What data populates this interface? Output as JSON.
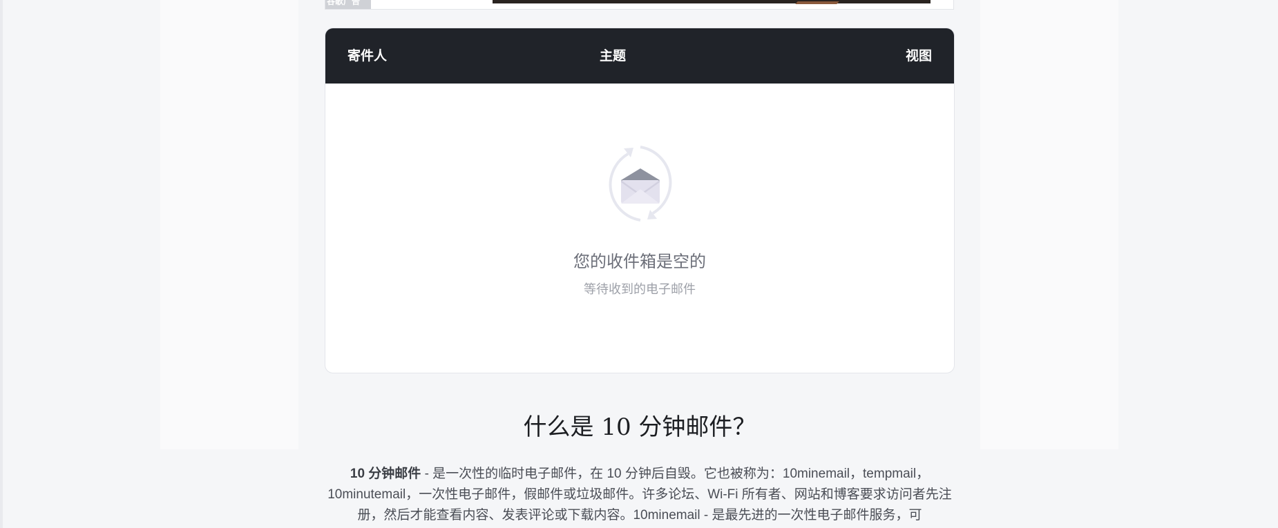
{
  "ad": {
    "label": "谷歌广告"
  },
  "inbox": {
    "columns": {
      "sender": "寄件人",
      "subject": "主题",
      "view": "视图"
    },
    "empty_title": "您的收件箱是空的",
    "empty_subtitle": "等待收到的电子邮件"
  },
  "about": {
    "title": "什么是 10 分钟邮件？",
    "lead_bold": "10 分钟邮件",
    "body": " - 是一次性的临时电子邮件，在 10 分钟后自毁。它也被称为：10minemail，tempmail，10minutemail，一次性电子邮件，假邮件或垃圾邮件。许多论坛、Wi-Fi 所有者、网站和博客要求访问者先注册，然后才能查看内容、发表评论或下载内容。10minemail - 是最先进的一次性电子邮件服务，可"
  },
  "colors": {
    "header_bg": "#202329",
    "page_bg": "#f5f6f8"
  }
}
